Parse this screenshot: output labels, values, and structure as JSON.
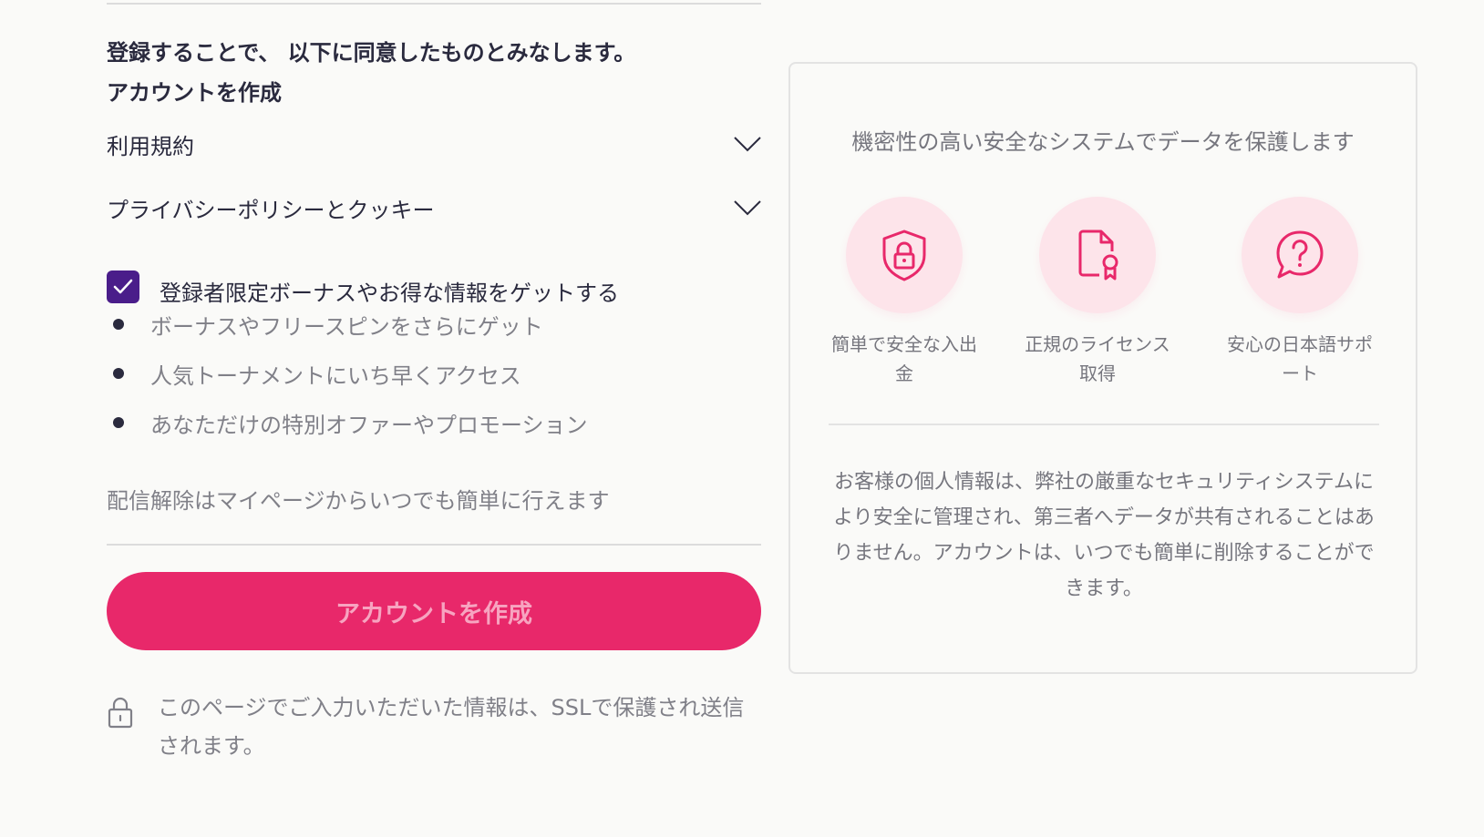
{
  "form": {
    "agree_notice": "登録することで、 以下に同意したものとみなします。",
    "agree_subject": "アカウントを作成",
    "accordions": [
      {
        "label": "利用規約"
      },
      {
        "label": "プライバシーポリシーとクッキー"
      }
    ],
    "optin": {
      "label": "登録者限定ボーナスやお得な情報をゲットする",
      "checked": true
    },
    "benefits": [
      "ボーナスやフリースピンをさらにゲット",
      "人気トーナメントにいち早くアクセス",
      "あなただけの特別オファーやプロモーション"
    ],
    "unsubscribe_note": "配信解除はマイページからいつでも簡単に行えます",
    "submit_label": "アカウントを作成",
    "ssl_note": "このページでご入力いただいた情報は、SSLで保護され送信されます。"
  },
  "security_card": {
    "title": "機密性の高い安全なシステムでデータを保護します",
    "features": [
      {
        "icon": "shield-lock-icon",
        "label": "簡単で安全な入出金"
      },
      {
        "icon": "license-certificate-icon",
        "label": "正規のライセンス取得"
      },
      {
        "icon": "support-chat-icon",
        "label": "安心の日本語サポート"
      }
    ],
    "body": "お客様の個人情報は、弊社の厳重なセキュリティシステムにより安全に管理され、第三者へデータが共有されることはありません。アカウントは、いつでも簡単に削除することができます。"
  },
  "colors": {
    "accent": "#e8286a",
    "checkbox": "#4a1d8a",
    "icon_bg": "#fde4ea"
  }
}
